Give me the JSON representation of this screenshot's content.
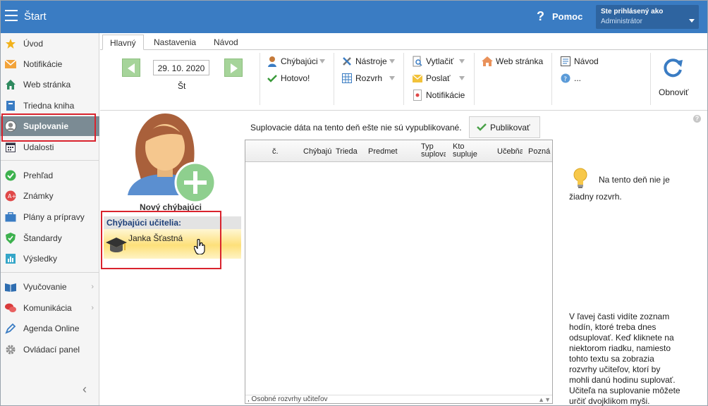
{
  "header": {
    "title": "Štart",
    "help_label": "Pomoc",
    "help_icon": "?",
    "login_line1": "Ste prihlásený ako",
    "login_line2": "Administrátor"
  },
  "sidebar": {
    "items": [
      {
        "label": "Úvod",
        "icon": "star-icon"
      },
      {
        "label": "Notifikácie",
        "icon": "envelope-icon"
      },
      {
        "label": "Web stránka",
        "icon": "house-icon"
      },
      {
        "label": "Triedna kniha",
        "icon": "book-icon"
      },
      {
        "label": "Suplovanie",
        "icon": "user-silhouette-icon",
        "active": true
      },
      {
        "label": "Udalosti",
        "icon": "calendar-icon"
      },
      {
        "label": "Prehľad",
        "icon": "check-circle-icon"
      },
      {
        "label": "Známky",
        "icon": "grade-icon"
      },
      {
        "label": "Plány a prípravy",
        "icon": "briefcase-icon"
      },
      {
        "label": "Štandardy",
        "icon": "shield-icon"
      },
      {
        "label": "Výsledky",
        "icon": "bar-chart-icon"
      },
      {
        "label": "Vyučovanie",
        "icon": "open-book-icon"
      },
      {
        "label": "Komunikácia",
        "icon": "chat-icon"
      },
      {
        "label": "Agenda Online",
        "icon": "pen-icon"
      },
      {
        "label": "Ovládací panel",
        "icon": "gear-icon"
      }
    ],
    "collapse_glyph": "‹"
  },
  "tabs": [
    "Hlavný",
    "Nastavenia",
    "Návod"
  ],
  "ribbon": {
    "date": "29. 10. 2020",
    "day": "Št",
    "absent_btn": "Chýbajúci",
    "done_btn": "Hotovo!",
    "tools_btn": "Nástroje",
    "schedule_btn": "Rozvrh",
    "print_btn": "Vytlačiť",
    "send_btn": "Poslať",
    "notif_btn": "Notifikácie",
    "web_btn": "Web stránka",
    "guide_btn": "Návod",
    "more_btn": "...",
    "refresh_btn": "Obnoviť"
  },
  "left_panel": {
    "new_absent": "Nový chýbajúci",
    "absent_header": "Chýbajúci učitelia:",
    "teachers": [
      "Janka Šťastná"
    ]
  },
  "center": {
    "notice": "Suplovacie dáta na tento deň ešte nie sú vypublikované.",
    "publish_btn": "Publikovať",
    "columns": [
      "č.",
      "Chýbajú",
      "Trieda",
      "Predmet",
      "Typ suplova",
      "Kto supluje",
      "Učebňa",
      "Pozná"
    ],
    "footer": ", Osobné rozvrhy učiteľov"
  },
  "right_panel": {
    "info_top": "Na tento deň nie je žiadny rozvrh.",
    "info_bottom": "V ľavej časti vidíte zoznam hodín, ktoré treba dnes odsuplovať. Keď kliknete na niektorom riadku, namiesto tohto textu sa zobrazia rozvrhy učiteľov, ktorí by mohli danú hodinu suplovať. Učiteľa na suplovanie môžete určiť dvojklikom myši.",
    "help_glyph": "?"
  },
  "colors": {
    "header_blue": "#3a7cc3",
    "active_sidebar": "#7b8b94",
    "highlight_red": "#d9232d",
    "selected_row": "#fde07a"
  }
}
